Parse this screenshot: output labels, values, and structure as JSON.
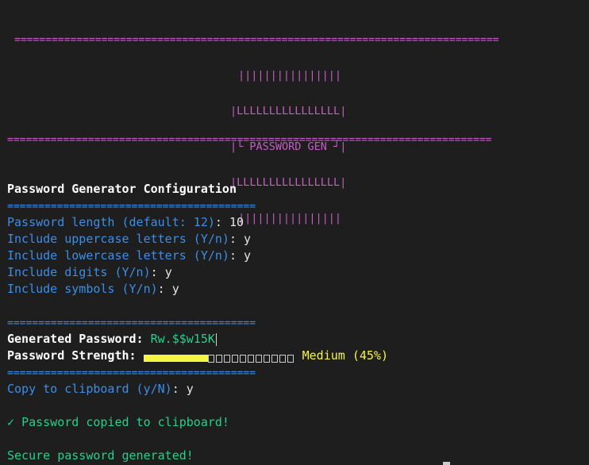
{
  "banner": {
    "rule": "==============================================================================",
    "top_bars": "||||||||||||||||",
    "title": "PASSWORD GEN",
    "title_edge_left": "|└",
    "title_edge_right": "┘|",
    "under_title": "|LLLLLLLLLLLLLLLL|",
    "bottom_bars": "||||||||||||||||"
  },
  "config": {
    "heading": "Password Generator Configuration",
    "rule": "========================================",
    "prompts": [
      {
        "label": "Password length (default: 12)",
        "sep": ": ",
        "answer": "10"
      },
      {
        "label": "Include uppercase letters (Y/n)",
        "sep": ": ",
        "answer": "y"
      },
      {
        "label": "Include lowercase letters (Y/n)",
        "sep": ": ",
        "answer": "y"
      },
      {
        "label": "Include digits (Y/n)",
        "sep": ": ",
        "answer": "y"
      },
      {
        "label": "Include symbols (Y/n)",
        "sep": ": ",
        "answer": "y"
      }
    ]
  },
  "result": {
    "generated_label": "Generated Password:",
    "generated_value": "Rw.$$w15K",
    "strength_label": "Password Strength:",
    "strength_fraction": 0.45,
    "strength_text": "Medium (45%)",
    "clipboard_prompt": "Copy to clipboard (y/N)",
    "clipboard_sep": ": ",
    "clipboard_answer": "y",
    "copied_check": "✓",
    "copied_message": "Password copied to clipboard!",
    "final_message": "Secure password generated!"
  },
  "colors": {
    "background": "#1e1e1e",
    "magenta": "#c65ec6",
    "blue": "#3b8eea",
    "green": "#23d18b",
    "yellow": "#f5f543"
  }
}
